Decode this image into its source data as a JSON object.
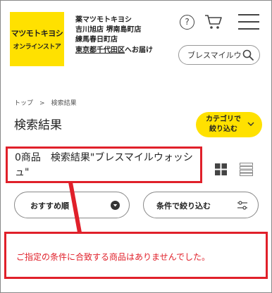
{
  "header": {
    "logo": {
      "main": "マツモトキヨシ",
      "sub": "オンラインストア"
    },
    "store": {
      "lines": [
        "薬マツモトキヨシ",
        "吉川旭店 堺南島町店",
        "練馬春日町店"
      ],
      "delivery_area": "東京都千代田区",
      "delivery_suffix": "へお届け"
    },
    "icons": {
      "help": "?"
    },
    "search": {
      "value": "ブレスマイルウォッシュ"
    }
  },
  "breadcrumb": {
    "home": "トップ",
    "separator": ">",
    "current": "検索結果"
  },
  "page": {
    "title": "検索結果",
    "category_button": {
      "line1": "カテゴリで",
      "line2": "絞り込む"
    },
    "result_summary": "0商品　検索結果\"ブレスマイルウォッシュ\"",
    "sort_button": "おすすめ順",
    "filter_button": "条件で絞り込む",
    "empty_message": "ご指定の条件に合致する商品はありませんでした。"
  },
  "colors": {
    "brand_yellow": "#ffe100",
    "highlight_red": "#e0202a"
  }
}
